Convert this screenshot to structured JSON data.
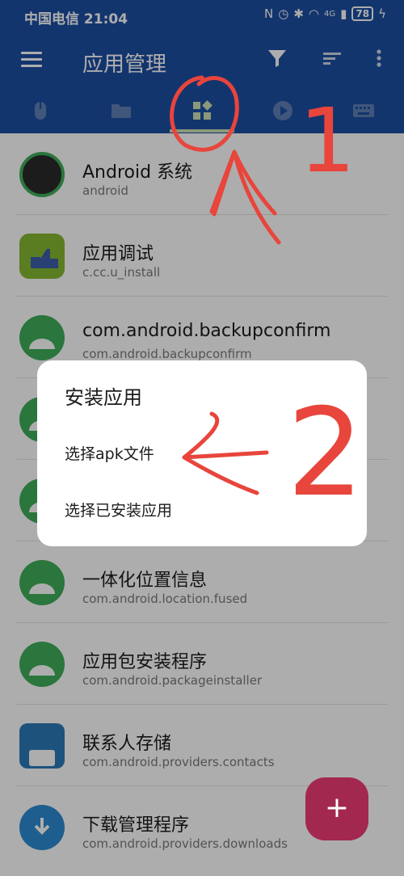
{
  "status": {
    "carrier_time": "中国电信 21:04",
    "network": "4G",
    "battery": "78"
  },
  "app_bar": {
    "title": "应用管理"
  },
  "apps": [
    {
      "name": "Android 系统",
      "package": "android",
      "icon": "android-system-icon"
    },
    {
      "name": "应用调试",
      "package": "c.cc.u_install",
      "icon": "thumbs-up-icon"
    },
    {
      "name": "com.android.backupconfirm",
      "package": "com.android.backupconfirm",
      "icon": "android-icon"
    },
    {
      "name": "",
      "package": "",
      "icon": "android-icon"
    },
    {
      "name": "",
      "package": "",
      "icon": "android-icon"
    },
    {
      "name": "一体化位置信息",
      "package": "com.android.location.fused",
      "icon": "android-icon"
    },
    {
      "name": "应用包安装程序",
      "package": "com.android.packageinstaller",
      "icon": "android-icon"
    },
    {
      "name": "联系人存储",
      "package": "com.android.providers.contacts",
      "icon": "contacts-icon"
    },
    {
      "name": "下载管理程序",
      "package": "com.android.providers.downloads",
      "icon": "download-icon"
    }
  ],
  "dialog": {
    "title": "安装应用",
    "option_apk": "选择apk文件",
    "option_installed": "选择已安装应用"
  },
  "fab": {
    "label": "+"
  },
  "annotations": {
    "label_1": "1",
    "label_2": "2",
    "color": "#e8453c"
  },
  "colors": {
    "primary": "#1c4fa3",
    "tab_icon": "#cde0b6",
    "fab": "#a3284f",
    "android_green": "#3fae5a"
  }
}
